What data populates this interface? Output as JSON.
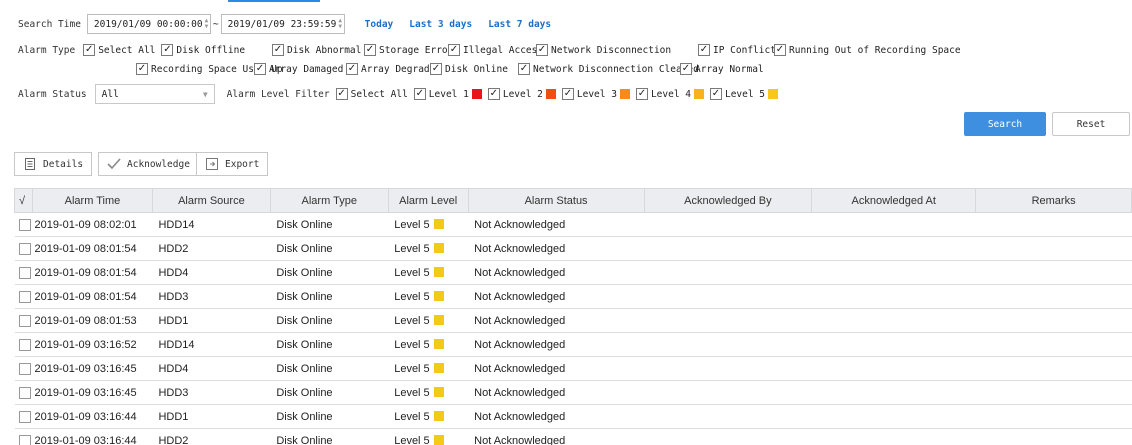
{
  "search": {
    "time_label": "Search Time",
    "start": "2019/01/09 00:00:00",
    "tilde": "~",
    "end": "2019/01/09 23:59:59",
    "quick": [
      "Today",
      "Last 3 days",
      "Last 7 days"
    ]
  },
  "alarm_type": {
    "label": "Alarm Type",
    "row1": [
      "Select All",
      "Disk Offline",
      "Disk Abnormal",
      "Storage Error",
      "Illegal Access",
      "Network Disconnection",
      "IP Conflict",
      "Running Out of Recording Space"
    ],
    "row2": [
      "Recording Space Used Up",
      "Array Damaged",
      "Array Degraded",
      "Disk Online",
      "Network Disconnection Cleared",
      "Array Normal"
    ]
  },
  "alarm_status": {
    "label": "Alarm Status",
    "value": "All"
  },
  "level_filter": {
    "label": "Alarm Level Filter",
    "select_all": "Select All",
    "levels": [
      {
        "label": "Level 1",
        "color": "#e8141e"
      },
      {
        "label": "Level 2",
        "color": "#f04e14"
      },
      {
        "label": "Level 3",
        "color": "#f58a1e"
      },
      {
        "label": "Level 4",
        "color": "#f5b419"
      },
      {
        "label": "Level 5",
        "color": "#f7c81c"
      }
    ]
  },
  "buttons": {
    "search": "Search",
    "reset": "Reset",
    "details": "Details",
    "acknowledge": "Acknowledge",
    "export": "Export"
  },
  "table": {
    "check_header": "√",
    "columns": [
      "Alarm Time",
      "Alarm Source",
      "Alarm Type",
      "Alarm Level",
      "Alarm Status",
      "Acknowledged By",
      "Acknowledged At",
      "Remarks"
    ],
    "level_color": "#f7c81c",
    "rows": [
      [
        "2019-01-09 08:02:01",
        "HDD14",
        "Disk Online",
        "Level 5",
        "Not Acknowledged",
        "",
        "",
        ""
      ],
      [
        "2019-01-09 08:01:54",
        "HDD2",
        "Disk Online",
        "Level 5",
        "Not Acknowledged",
        "",
        "",
        ""
      ],
      [
        "2019-01-09 08:01:54",
        "HDD4",
        "Disk Online",
        "Level 5",
        "Not Acknowledged",
        "",
        "",
        ""
      ],
      [
        "2019-01-09 08:01:54",
        "HDD3",
        "Disk Online",
        "Level 5",
        "Not Acknowledged",
        "",
        "",
        ""
      ],
      [
        "2019-01-09 08:01:53",
        "HDD1",
        "Disk Online",
        "Level 5",
        "Not Acknowledged",
        "",
        "",
        ""
      ],
      [
        "2019-01-09 03:16:52",
        "HDD14",
        "Disk Online",
        "Level 5",
        "Not Acknowledged",
        "",
        "",
        ""
      ],
      [
        "2019-01-09 03:16:45",
        "HDD4",
        "Disk Online",
        "Level 5",
        "Not Acknowledged",
        "",
        "",
        ""
      ],
      [
        "2019-01-09 03:16:45",
        "HDD3",
        "Disk Online",
        "Level 5",
        "Not Acknowledged",
        "",
        "",
        ""
      ],
      [
        "2019-01-09 03:16:44",
        "HDD1",
        "Disk Online",
        "Level 5",
        "Not Acknowledged",
        "",
        "",
        ""
      ],
      [
        "2019-01-09 03:16:44",
        "HDD2",
        "Disk Online",
        "Level 5",
        "Not Acknowledged",
        "",
        "",
        ""
      ]
    ]
  }
}
